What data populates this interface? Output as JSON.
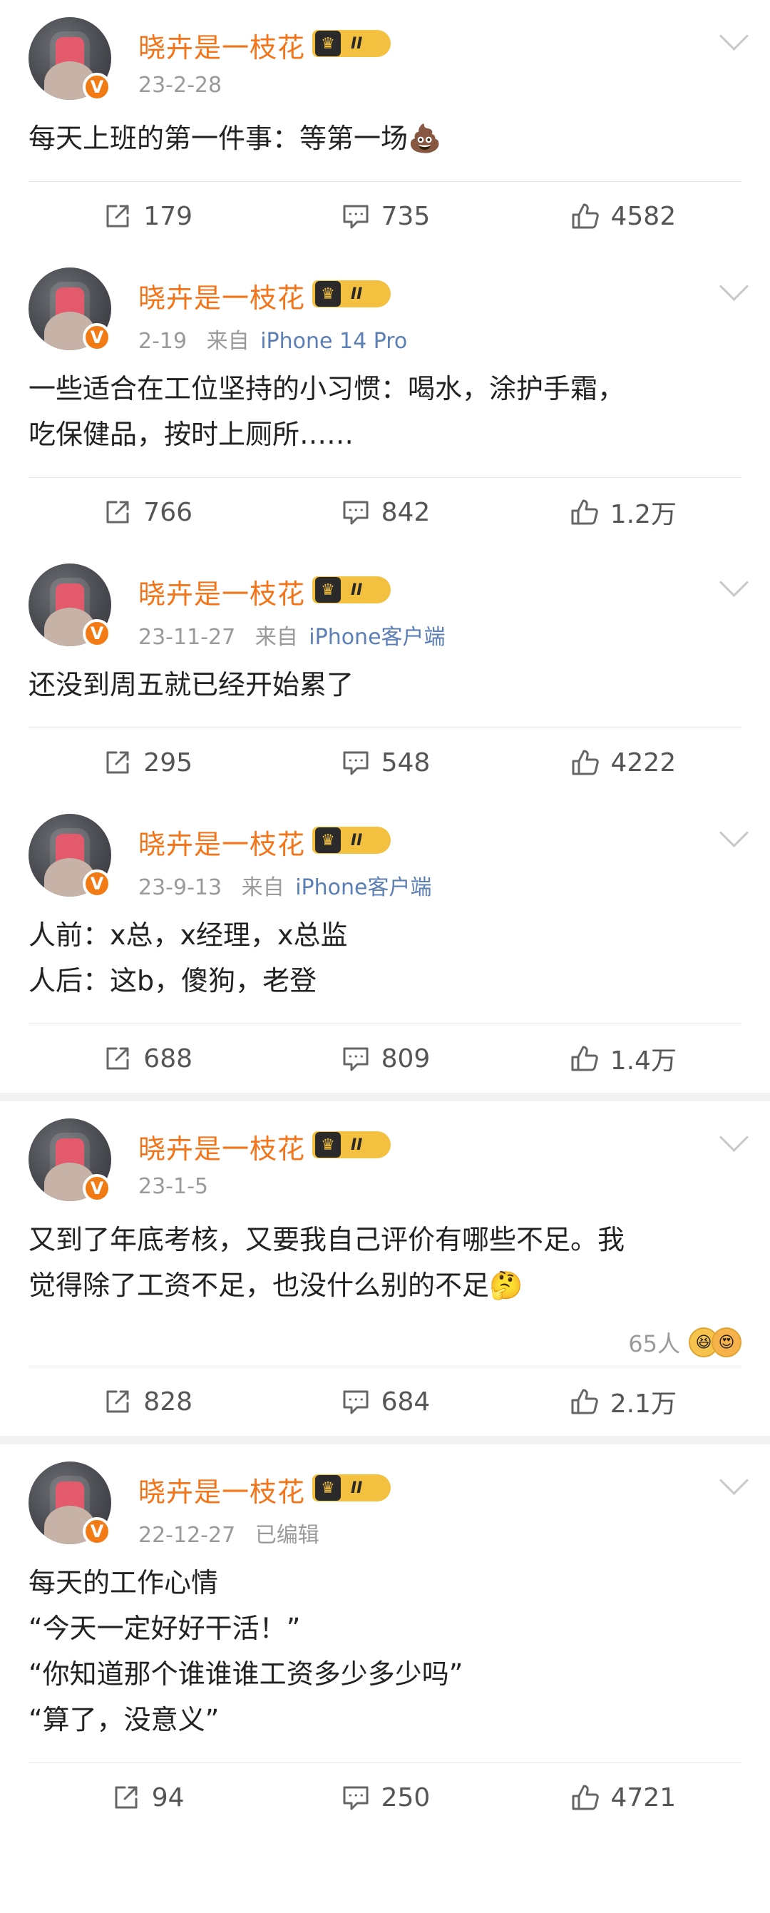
{
  "posts": [
    {
      "user": "晓卉是一枝花",
      "level": "II",
      "date": "23-2-28",
      "source_prefix": "",
      "device": "",
      "text": "每天上班的第一件事：等第一场💩",
      "repost": "179",
      "comment": "735",
      "like": "4582"
    },
    {
      "user": "晓卉是一枝花",
      "level": "II",
      "date": "2-19",
      "source_prefix": "来自",
      "device": "iPhone 14 Pro",
      "text": "一些适合在工位坚持的小习惯：喝水，涂护手霜，\n吃保健品，按时上厕所……",
      "repost": "766",
      "comment": "842",
      "like": "1.2万"
    },
    {
      "user": "晓卉是一枝花",
      "level": "II",
      "date": "23-11-27",
      "source_prefix": "来自",
      "device": "iPhone客户端",
      "text": "还没到周五就已经开始累了",
      "repost": "295",
      "comment": "548",
      "like": "4222"
    },
    {
      "user": "晓卉是一枝花",
      "level": "II",
      "date": "23-9-13",
      "source_prefix": "来自",
      "device": "iPhone客户端",
      "text": "人前：x总，x经理，x总监\n人后：这b，傻狗，老登",
      "repost": "688",
      "comment": "809",
      "like": "1.4万"
    },
    {
      "user": "晓卉是一枝花",
      "level": "II",
      "date": "23-1-5",
      "source_prefix": "",
      "device": "",
      "text": "又到了年底考核，又要我自己评价有哪些不足。我\n觉得除了工资不足，也没什么别的不足🤔",
      "reactions": "65人",
      "repost": "828",
      "comment": "684",
      "like": "2.1万"
    },
    {
      "user": "晓卉是一枝花",
      "level": "II",
      "date": "22-12-27",
      "source_prefix": "已编辑",
      "device": "",
      "text": "每天的工作心情\n“今天一定好好干活！”\n“你知道那个谁谁谁工资多少多少吗”\n“算了，没意义”",
      "repost": "94",
      "comment": "250",
      "like": "4721"
    }
  ]
}
